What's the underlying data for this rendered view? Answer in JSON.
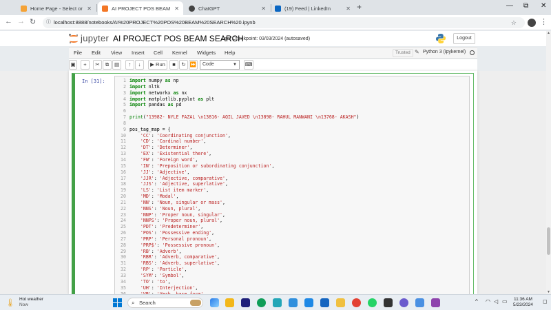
{
  "browser": {
    "tabs": [
      {
        "title": "Home Page - Select or create a",
        "active": false,
        "favicon_color": "#f4a236"
      },
      {
        "title": "AI PROJECT POS BEAM SEARCH",
        "active": true,
        "favicon_color": "#f37726"
      },
      {
        "title": "ChatGPT",
        "active": false,
        "favicon_color": "#444444"
      },
      {
        "title": "(19) Feed | LinkedIn",
        "active": false,
        "favicon_color": "#0a66c2"
      }
    ],
    "new_tab_label": "+",
    "url": "localhost:8888/notebooks/AI%20PROJECT%20POS%20BEAM%20SEARCH%20.ipynb",
    "window_controls": [
      "—",
      "⧉",
      "✕"
    ]
  },
  "jupyter": {
    "logo_text": "jupyter",
    "notebook_title": "AI PROJECT POS BEAM SEARCH",
    "checkpoint": "Last Checkpoint: 03/03/2024  (autosaved)",
    "logout_label": "Logout",
    "menu": [
      "File",
      "Edit",
      "View",
      "Insert",
      "Cell",
      "Kernel",
      "Widgets",
      "Help"
    ],
    "trusted_label": "Trusted",
    "kernel_label": "Python 3 (ipykernel)",
    "toolbar": {
      "run_label": "Run",
      "cell_type": "Code"
    }
  },
  "cell": {
    "prompt": "In [31]:",
    "lines": [
      {
        "n": "1",
        "parts": [
          [
            "kw",
            "import"
          ],
          [
            "plain",
            " numpy "
          ],
          [
            "kw",
            "as"
          ],
          [
            "plain",
            " np"
          ]
        ]
      },
      {
        "n": "2",
        "parts": [
          [
            "kw",
            "import"
          ],
          [
            "plain",
            " nltk"
          ]
        ]
      },
      {
        "n": "3",
        "parts": [
          [
            "kw",
            "import"
          ],
          [
            "plain",
            " networkx "
          ],
          [
            "kw",
            "as"
          ],
          [
            "plain",
            " nx"
          ]
        ]
      },
      {
        "n": "4",
        "parts": [
          [
            "kw",
            "import"
          ],
          [
            "plain",
            " matplotlib.pyplot "
          ],
          [
            "kw",
            "as"
          ],
          [
            "plain",
            " plt"
          ]
        ]
      },
      {
        "n": "5",
        "parts": [
          [
            "kw",
            "import"
          ],
          [
            "plain",
            " pandas "
          ],
          [
            "kw",
            "as"
          ],
          [
            "plain",
            " pd"
          ]
        ]
      },
      {
        "n": "6",
        "parts": []
      },
      {
        "n": "7",
        "parts": [
          [
            "fn",
            "print"
          ],
          [
            "plain",
            "("
          ],
          [
            "str",
            "\"13982- NYLE FAZAL \\n13816- AQIL JAVED \\n13898- RAHUL MANWANI \\n13768- AKASH\""
          ],
          [
            "plain",
            ")"
          ]
        ]
      },
      {
        "n": "8",
        "parts": []
      },
      {
        "n": "9",
        "parts": [
          [
            "plain",
            "pos_tag_map = {"
          ]
        ]
      },
      {
        "n": "10",
        "parts": [
          [
            "plain",
            "    "
          ],
          [
            "str",
            "'CC'"
          ],
          [
            "plain",
            ": "
          ],
          [
            "str",
            "'Coordinating conjunction'"
          ],
          [
            "plain",
            ","
          ]
        ]
      },
      {
        "n": "11",
        "parts": [
          [
            "plain",
            "    "
          ],
          [
            "str",
            "'CD'"
          ],
          [
            "plain",
            ": "
          ],
          [
            "str",
            "'Cardinal number'"
          ],
          [
            "plain",
            ","
          ]
        ]
      },
      {
        "n": "12",
        "parts": [
          [
            "plain",
            "    "
          ],
          [
            "str",
            "'DT'"
          ],
          [
            "plain",
            ": "
          ],
          [
            "str",
            "'Determiner'"
          ],
          [
            "plain",
            ","
          ]
        ]
      },
      {
        "n": "13",
        "parts": [
          [
            "plain",
            "    "
          ],
          [
            "str",
            "'EX'"
          ],
          [
            "plain",
            ": "
          ],
          [
            "str",
            "'Existential there'"
          ],
          [
            "plain",
            ","
          ]
        ]
      },
      {
        "n": "14",
        "parts": [
          [
            "plain",
            "    "
          ],
          [
            "str",
            "'FW'"
          ],
          [
            "plain",
            ": "
          ],
          [
            "str",
            "'Foreign word'"
          ],
          [
            "plain",
            ","
          ]
        ]
      },
      {
        "n": "15",
        "parts": [
          [
            "plain",
            "    "
          ],
          [
            "str",
            "'IN'"
          ],
          [
            "plain",
            ": "
          ],
          [
            "str",
            "'Preposition or subordinating conjunction'"
          ],
          [
            "plain",
            ","
          ]
        ]
      },
      {
        "n": "16",
        "parts": [
          [
            "plain",
            "    "
          ],
          [
            "str",
            "'JJ'"
          ],
          [
            "plain",
            ": "
          ],
          [
            "str",
            "'Adjective'"
          ],
          [
            "plain",
            ","
          ]
        ]
      },
      {
        "n": "17",
        "parts": [
          [
            "plain",
            "    "
          ],
          [
            "str",
            "'JJR'"
          ],
          [
            "plain",
            ": "
          ],
          [
            "str",
            "'Adjective, comparative'"
          ],
          [
            "plain",
            ","
          ]
        ]
      },
      {
        "n": "18",
        "parts": [
          [
            "plain",
            "    "
          ],
          [
            "str",
            "'JJS'"
          ],
          [
            "plain",
            ": "
          ],
          [
            "str",
            "'Adjective, superlative'"
          ],
          [
            "plain",
            ","
          ]
        ]
      },
      {
        "n": "19",
        "parts": [
          [
            "plain",
            "    "
          ],
          [
            "str",
            "'LS'"
          ],
          [
            "plain",
            ": "
          ],
          [
            "str",
            "'List item marker'"
          ],
          [
            "plain",
            ","
          ]
        ]
      },
      {
        "n": "20",
        "parts": [
          [
            "plain",
            "    "
          ],
          [
            "str",
            "'MD'"
          ],
          [
            "plain",
            ": "
          ],
          [
            "str",
            "'Modal'"
          ],
          [
            "plain",
            ","
          ]
        ]
      },
      {
        "n": "21",
        "parts": [
          [
            "plain",
            "    "
          ],
          [
            "str",
            "'NN'"
          ],
          [
            "plain",
            ": "
          ],
          [
            "str",
            "'Noun, singular or mass'"
          ],
          [
            "plain",
            ","
          ]
        ]
      },
      {
        "n": "22",
        "parts": [
          [
            "plain",
            "    "
          ],
          [
            "str",
            "'NNS'"
          ],
          [
            "plain",
            ": "
          ],
          [
            "str",
            "'Noun, plural'"
          ],
          [
            "plain",
            ","
          ]
        ]
      },
      {
        "n": "23",
        "parts": [
          [
            "plain",
            "    "
          ],
          [
            "str",
            "'NNP'"
          ],
          [
            "plain",
            ": "
          ],
          [
            "str",
            "'Proper noun, singular'"
          ],
          [
            "plain",
            ","
          ]
        ]
      },
      {
        "n": "24",
        "parts": [
          [
            "plain",
            "    "
          ],
          [
            "str",
            "'NNPS'"
          ],
          [
            "plain",
            ": "
          ],
          [
            "str",
            "'Proper noun, plural'"
          ],
          [
            "plain",
            ","
          ]
        ]
      },
      {
        "n": "25",
        "parts": [
          [
            "plain",
            "    "
          ],
          [
            "str",
            "'PDT'"
          ],
          [
            "plain",
            ": "
          ],
          [
            "str",
            "'Predeterminer'"
          ],
          [
            "plain",
            ","
          ]
        ]
      },
      {
        "n": "26",
        "parts": [
          [
            "plain",
            "    "
          ],
          [
            "str",
            "'POS'"
          ],
          [
            "plain",
            ": "
          ],
          [
            "str",
            "'Possessive ending'"
          ],
          [
            "plain",
            ","
          ]
        ]
      },
      {
        "n": "27",
        "parts": [
          [
            "plain",
            "    "
          ],
          [
            "str",
            "'PRP'"
          ],
          [
            "plain",
            ": "
          ],
          [
            "str",
            "'Personal pronoun'"
          ],
          [
            "plain",
            ","
          ]
        ]
      },
      {
        "n": "28",
        "parts": [
          [
            "plain",
            "    "
          ],
          [
            "str",
            "'PRP$'"
          ],
          [
            "plain",
            ": "
          ],
          [
            "str",
            "'Possessive pronoun'"
          ],
          [
            "plain",
            ","
          ]
        ]
      },
      {
        "n": "29",
        "parts": [
          [
            "plain",
            "    "
          ],
          [
            "str",
            "'RB'"
          ],
          [
            "plain",
            ": "
          ],
          [
            "str",
            "'Adverb'"
          ],
          [
            "plain",
            ","
          ]
        ]
      },
      {
        "n": "30",
        "parts": [
          [
            "plain",
            "    "
          ],
          [
            "str",
            "'RBR'"
          ],
          [
            "plain",
            ": "
          ],
          [
            "str",
            "'Adverb, comparative'"
          ],
          [
            "plain",
            ","
          ]
        ]
      },
      {
        "n": "31",
        "parts": [
          [
            "plain",
            "    "
          ],
          [
            "str",
            "'RBS'"
          ],
          [
            "plain",
            ": "
          ],
          [
            "str",
            "'Adverb, superlative'"
          ],
          [
            "plain",
            ","
          ]
        ]
      },
      {
        "n": "32",
        "parts": [
          [
            "plain",
            "    "
          ],
          [
            "str",
            "'RP'"
          ],
          [
            "plain",
            ": "
          ],
          [
            "str",
            "'Particle'"
          ],
          [
            "plain",
            ","
          ]
        ]
      },
      {
        "n": "33",
        "parts": [
          [
            "plain",
            "    "
          ],
          [
            "str",
            "'SYM'"
          ],
          [
            "plain",
            ": "
          ],
          [
            "str",
            "'Symbol'"
          ],
          [
            "plain",
            ","
          ]
        ]
      },
      {
        "n": "34",
        "parts": [
          [
            "plain",
            "    "
          ],
          [
            "str",
            "'TO'"
          ],
          [
            "plain",
            ": "
          ],
          [
            "str",
            "'to'"
          ],
          [
            "plain",
            ","
          ]
        ]
      },
      {
        "n": "35",
        "parts": [
          [
            "plain",
            "    "
          ],
          [
            "str",
            "'UH'"
          ],
          [
            "plain",
            ": "
          ],
          [
            "str",
            "'Interjection'"
          ],
          [
            "plain",
            ","
          ]
        ]
      },
      {
        "n": "36",
        "parts": [
          [
            "plain",
            "    "
          ],
          [
            "str",
            "'VB'"
          ],
          [
            "plain",
            ": "
          ],
          [
            "str",
            "'Verb, base form'"
          ],
          [
            "plain",
            ","
          ]
        ]
      }
    ]
  },
  "taskbar": {
    "weather_title": "Hot weather",
    "weather_sub": "Now",
    "search_placeholder": "Search",
    "time": "11:36 AM",
    "date": "5/23/2024"
  }
}
